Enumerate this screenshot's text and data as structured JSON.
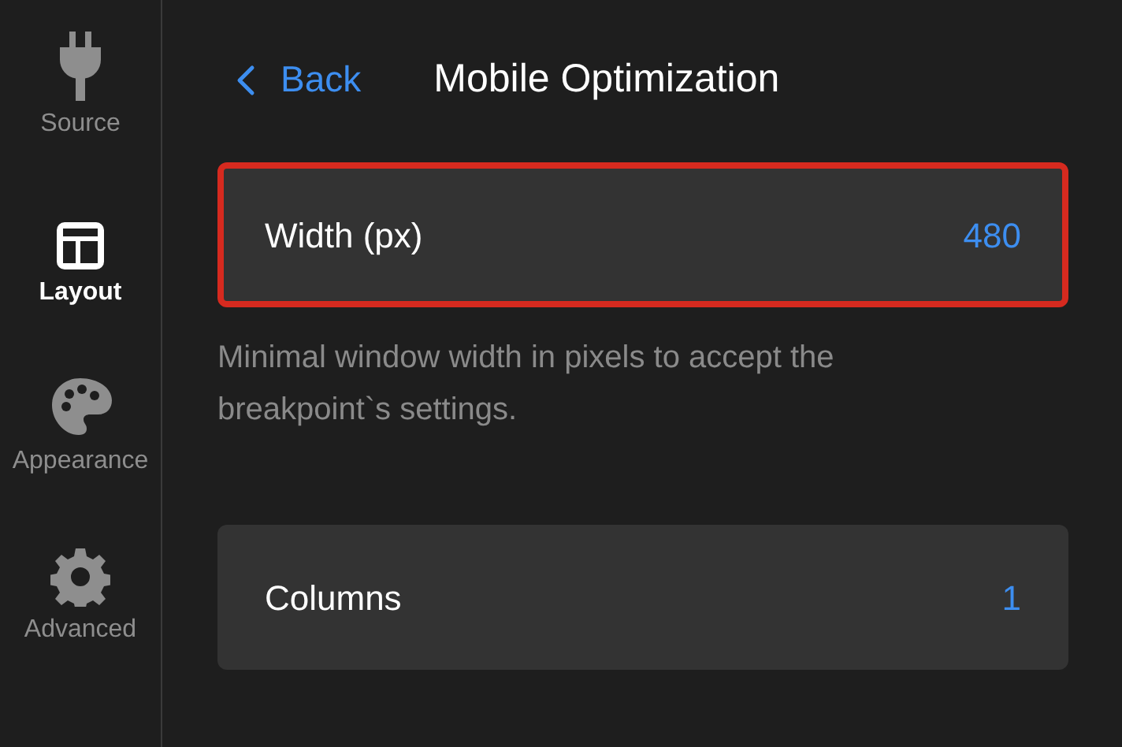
{
  "sidebar": {
    "items": [
      {
        "label": "Source",
        "selected": false
      },
      {
        "label": "Layout",
        "selected": true
      },
      {
        "label": "Appearance",
        "selected": false
      },
      {
        "label": "Advanced",
        "selected": false
      }
    ]
  },
  "header": {
    "back": "Back",
    "title": "Mobile Optimization"
  },
  "settings": [
    {
      "label": "Width (px)",
      "value": "480",
      "highlighted": true,
      "description": "Minimal window width in pixels to accept the breakpoint`s settings."
    },
    {
      "label": "Columns",
      "value": "1",
      "highlighted": false
    }
  ]
}
